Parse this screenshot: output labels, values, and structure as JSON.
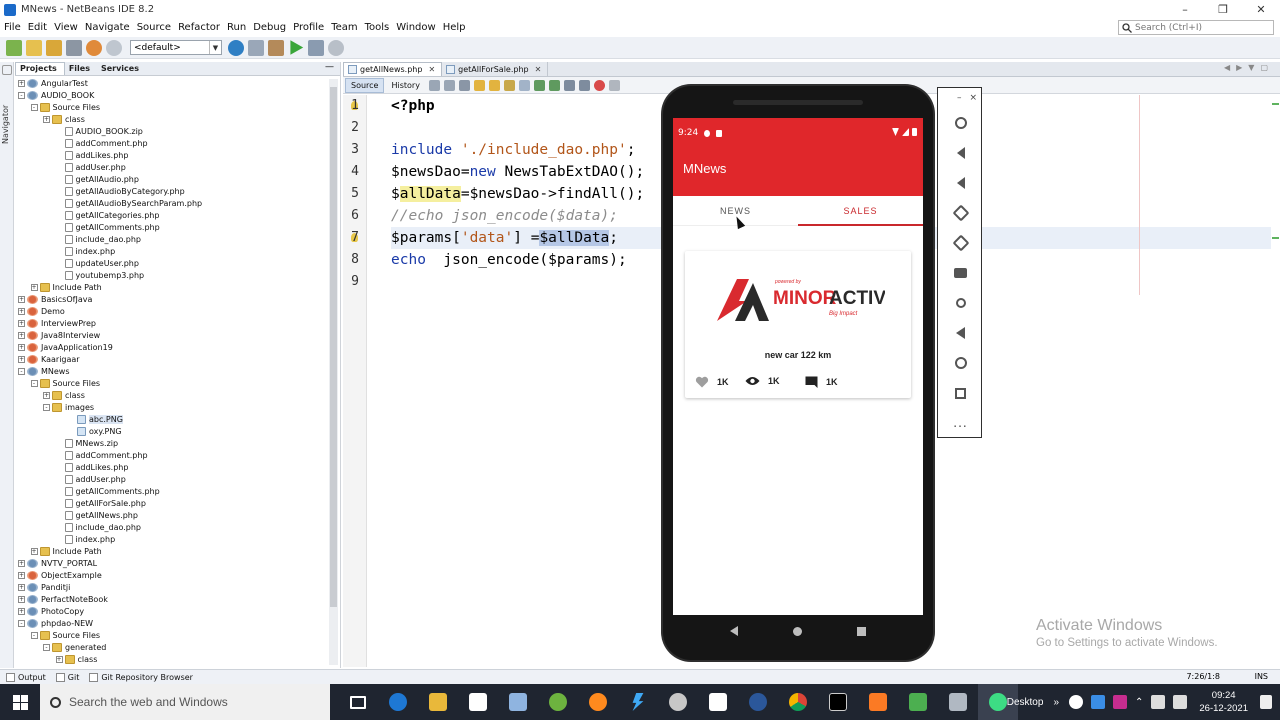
{
  "window": {
    "title": "MNews - NetBeans IDE 8.2"
  },
  "menu": [
    "File",
    "Edit",
    "View",
    "Navigate",
    "Source",
    "Refactor",
    "Run",
    "Debug",
    "Profile",
    "Team",
    "Tools",
    "Window",
    "Help"
  ],
  "search": {
    "placeholder": "Search (Ctrl+I)"
  },
  "toolbar": {
    "config": "<default>"
  },
  "navigator_label": "Navigator",
  "panel_tabs": [
    "Projects",
    "Files",
    "Services"
  ],
  "tree": [
    {
      "label": "AngularTest",
      "type": "proj",
      "level": 0,
      "exp": "+"
    },
    {
      "label": "AUDIO_BOOK",
      "type": "proj",
      "level": 0,
      "exp": "-"
    },
    {
      "label": "Source Files",
      "type": "folder",
      "level": 1,
      "exp": "-"
    },
    {
      "label": "class",
      "type": "folder",
      "level": 2,
      "exp": "+"
    },
    {
      "label": "AUDIO_BOOK.zip",
      "type": "file",
      "level": 3
    },
    {
      "label": "addComment.php",
      "type": "file",
      "level": 3
    },
    {
      "label": "addLikes.php",
      "type": "file",
      "level": 3
    },
    {
      "label": "addUser.php",
      "type": "file",
      "level": 3
    },
    {
      "label": "getAllAudio.php",
      "type": "file",
      "level": 3
    },
    {
      "label": "getAllAudioByCategory.php",
      "type": "file",
      "level": 3
    },
    {
      "label": "getAllAudioBySearchParam.php",
      "type": "file",
      "level": 3
    },
    {
      "label": "getAllCategories.php",
      "type": "file",
      "level": 3
    },
    {
      "label": "getAllComments.php",
      "type": "file",
      "level": 3
    },
    {
      "label": "include_dao.php",
      "type": "file",
      "level": 3
    },
    {
      "label": "index.php",
      "type": "file",
      "level": 3
    },
    {
      "label": "updateUser.php",
      "type": "file",
      "level": 3
    },
    {
      "label": "youtubemp3.php",
      "type": "file",
      "level": 3
    },
    {
      "label": "Include Path",
      "type": "folder",
      "level": 1,
      "exp": "+"
    },
    {
      "label": "BasicsOfJava",
      "type": "projred",
      "level": 0,
      "exp": "+"
    },
    {
      "label": "Demo",
      "type": "projred",
      "level": 0,
      "exp": "+"
    },
    {
      "label": "InterviewPrep",
      "type": "projred",
      "level": 0,
      "exp": "+"
    },
    {
      "label": "Java8Interview",
      "type": "projred",
      "level": 0,
      "exp": "+"
    },
    {
      "label": "JavaApplication19",
      "type": "projred",
      "level": 0,
      "exp": "+"
    },
    {
      "label": "Kaarigaar",
      "type": "projred",
      "level": 0,
      "exp": "+"
    },
    {
      "label": "MNews",
      "type": "proj",
      "level": 0,
      "exp": "-"
    },
    {
      "label": "Source Files",
      "type": "folder",
      "level": 1,
      "exp": "-"
    },
    {
      "label": "class",
      "type": "folder",
      "level": 2,
      "exp": "+"
    },
    {
      "label": "images",
      "type": "folder",
      "level": 2,
      "exp": "-"
    },
    {
      "label": "abc.PNG",
      "type": "img",
      "level": 4,
      "sel": true
    },
    {
      "label": "oxy.PNG",
      "type": "img",
      "level": 4
    },
    {
      "label": "MNews.zip",
      "type": "file",
      "level": 3
    },
    {
      "label": "addComment.php",
      "type": "file",
      "level": 3
    },
    {
      "label": "addLikes.php",
      "type": "file",
      "level": 3
    },
    {
      "label": "addUser.php",
      "type": "file",
      "level": 3
    },
    {
      "label": "getAllComments.php",
      "type": "file",
      "level": 3
    },
    {
      "label": "getAllForSale.php",
      "type": "file",
      "level": 3
    },
    {
      "label": "getAllNews.php",
      "type": "file",
      "level": 3
    },
    {
      "label": "include_dao.php",
      "type": "file",
      "level": 3
    },
    {
      "label": "index.php",
      "type": "file",
      "level": 3
    },
    {
      "label": "Include Path",
      "type": "folder",
      "level": 1,
      "exp": "+"
    },
    {
      "label": "NVTV_PORTAL",
      "type": "proj",
      "level": 0,
      "exp": "+"
    },
    {
      "label": "ObjectExample",
      "type": "projred",
      "level": 0,
      "exp": "+"
    },
    {
      "label": "Panditji",
      "type": "proj",
      "level": 0,
      "exp": "+"
    },
    {
      "label": "PerfactNoteBook",
      "type": "proj",
      "level": 0,
      "exp": "+"
    },
    {
      "label": "PhotoCopy",
      "type": "proj",
      "level": 0,
      "exp": "+"
    },
    {
      "label": "phpdao-NEW",
      "type": "proj",
      "level": 0,
      "exp": "-"
    },
    {
      "label": "Source Files",
      "type": "folder",
      "level": 1,
      "exp": "-"
    },
    {
      "label": "generated",
      "type": "folder",
      "level": 2,
      "exp": "-"
    },
    {
      "label": "class",
      "type": "folder",
      "level": 3,
      "exp": "+"
    }
  ],
  "editor": {
    "tabs": [
      "getAllNews.php",
      "getAllForSale.php"
    ],
    "modes": [
      "Source",
      "History"
    ],
    "line_numbers": [
      "1",
      "2",
      "3",
      "4",
      "5",
      "6",
      "7",
      "8",
      "9"
    ]
  },
  "code": {
    "l1": "<?php",
    "l3_kw": "include",
    "l3_str": "'./include_dao.php'",
    "l3_end": ";",
    "l4_var": "$newsDao",
    "l4_op": "=",
    "l4_new": "new",
    "l4_rest": " NewsTabExtDAO();",
    "l5_pre": "$",
    "l5_hl": "allData",
    "l5_rest": "=$newsDao->findAll();",
    "l6": "//echo json_encode($data);",
    "l7_var": "$params[",
    "l7_str": "'data'",
    "l7_mid": "] =",
    "l7_sel": "$allData",
    "l7_end": ";",
    "l8_kw": "echo",
    "l8_rest": "  json_encode($params);"
  },
  "phone": {
    "time": "9:24",
    "app_title": "MNews",
    "tabs": [
      "NEWS",
      "SALES"
    ],
    "card": {
      "logo_small": "powered by",
      "logo_brand_a": "MINOR",
      "logo_brand_b": "ACTIVITY",
      "logo_tag": "Big Impact",
      "title": "new car 122 km",
      "likes": "1K",
      "views": "1K",
      "comments": "1K"
    }
  },
  "emulator_panel": {
    "minimize": "–",
    "close": "×",
    "more": "..."
  },
  "watermark": {
    "line1": "Activate Windows",
    "line2": "Go to Settings to activate Windows."
  },
  "status": {
    "items": [
      "Output",
      "Git",
      "Git Repository Browser"
    ],
    "position": "7:26/1:8",
    "mode": "INS"
  },
  "taskbar": {
    "search": "Search the web and Windows",
    "desktop": "Desktop",
    "time": "09:24",
    "date": "26-12-2021"
  },
  "colors": {
    "accent_red": "#e0272b",
    "tab_red": "#c9282c"
  }
}
